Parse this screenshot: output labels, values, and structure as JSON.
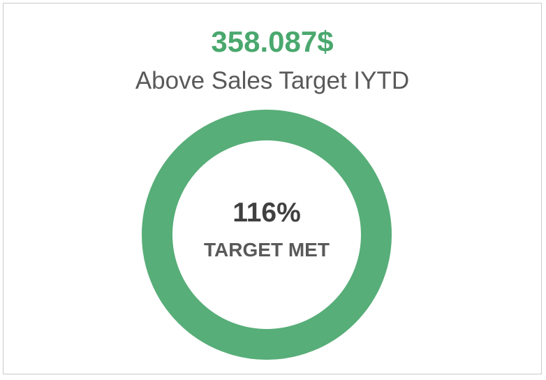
{
  "kpi": {
    "amount": "358.087$",
    "caption": "Above Sales Target IYTD",
    "percent_label": "116%",
    "status_label": "TARGET MET"
  },
  "colors": {
    "accent": "#57ae78",
    "amount_text": "#4aa86e",
    "track": "#e6e6e6"
  },
  "chart_data": {
    "type": "pie",
    "subtype": "donut",
    "values": [
      116
    ],
    "target": 100,
    "unit": "%",
    "title": "358.087$",
    "subtitle": "Above Sales Target IYTD",
    "center_labels": [
      "116%",
      "TARGET MET"
    ],
    "legend": "none"
  }
}
